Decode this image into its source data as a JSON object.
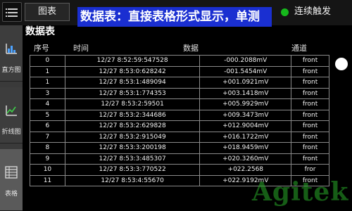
{
  "header": {
    "chart_tab_label": "图表",
    "banner_text": "数据表：直接表格形式显示，单测",
    "continuous_trigger_label": "连续触发"
  },
  "sidebar": {
    "items": [
      {
        "label": "直方图",
        "icon": "histogram-icon"
      },
      {
        "label": "折线图",
        "icon": "line-chart-icon"
      },
      {
        "label": "表格",
        "icon": "table-icon"
      }
    ]
  },
  "main": {
    "title": "数据表",
    "columns": [
      "序号",
      "时间",
      "数据",
      "通道"
    ],
    "rows": [
      {
        "index": "0",
        "time": "12/27 8:52:59:547528",
        "value": "-000.2088mV",
        "channel": "front"
      },
      {
        "index": "1",
        "time": "12/27 8:53:0:628242",
        "value": "-001.5454mV",
        "channel": "front"
      },
      {
        "index": "1",
        "time": "12/27 8:53:1:489094",
        "value": "+001.0921mV",
        "channel": "front"
      },
      {
        "index": "3",
        "time": "12/27 8:53:1:774353",
        "value": "+003.1418mV",
        "channel": "front"
      },
      {
        "index": "4",
        "time": "12/27 8:53:2:59501",
        "value": "+005.9929mV",
        "channel": "front"
      },
      {
        "index": "5",
        "time": "12/27 8:53:2:344686",
        "value": "+009.3473mV",
        "channel": "front"
      },
      {
        "index": "6",
        "time": "12/27 8:53:2:629828",
        "value": "+012.9004mV",
        "channel": "front"
      },
      {
        "index": "7",
        "time": "12/27 8:53:2:915049",
        "value": "+016.1722mV",
        "channel": "front"
      },
      {
        "index": "8",
        "time": "12/27 8:53:3:200198",
        "value": "+018.9459mV",
        "channel": "front"
      },
      {
        "index": "9",
        "time": "12/27 8:53:3:485307",
        "value": "+020.3260mV",
        "channel": "front"
      },
      {
        "index": "10",
        "time": "12/27 8:53:3:770522",
        "value": "+022.2568",
        "channel": "fror"
      },
      {
        "index": "11",
        "time": "12/27 8:53:4:55670",
        "value": "+022.9192mV",
        "channel": "front"
      }
    ]
  },
  "watermark": "Agitek",
  "colors": {
    "banner": "#1a2fd1",
    "status_green": "#16b81c",
    "watermark": "#28aa28"
  }
}
